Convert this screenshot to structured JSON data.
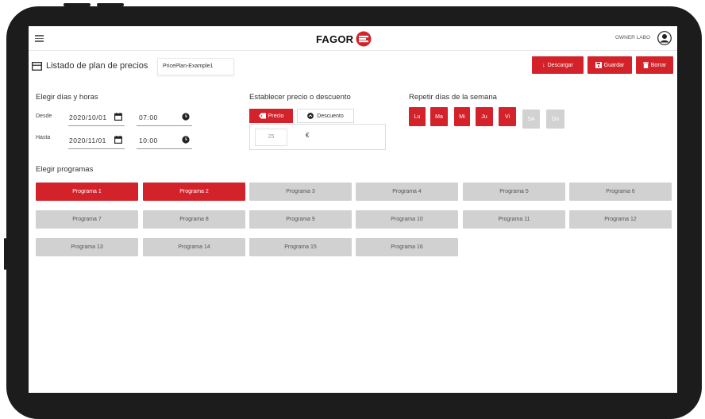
{
  "topbar": {
    "brand": "FAGOR",
    "owner": "OWNER LABO"
  },
  "header": {
    "title": "Listado de plan de precios",
    "plan_name": "PricePlan-Example1",
    "download_label": "Descargar",
    "save_label": "Guardar",
    "delete_label": "Borrar"
  },
  "schedule": {
    "title": "Elegir días y horas",
    "from_label": "Desde",
    "from_date": "2020/10/01",
    "from_time": "07:00",
    "to_label": "Hasta",
    "to_date": "2020/11/01",
    "to_time": "10:00"
  },
  "price": {
    "title": "Establecer precio o descuento",
    "price_label": "Precio",
    "discount_label": "Descuento",
    "value": "25",
    "currency": "€"
  },
  "days": {
    "title": "Repetir días de la semana",
    "items": [
      {
        "label": "Lu",
        "active": true
      },
      {
        "label": "Ma",
        "active": true
      },
      {
        "label": "Mi",
        "active": true
      },
      {
        "label": "Ju",
        "active": true
      },
      {
        "label": "Vi",
        "active": true
      },
      {
        "label": "SA",
        "active": false
      },
      {
        "label": "Do",
        "active": false
      }
    ]
  },
  "programs": {
    "title": "Elegir programas",
    "items": [
      {
        "label": "Programa 1",
        "active": true
      },
      {
        "label": "Programa 2",
        "active": true
      },
      {
        "label": "Programa 3",
        "active": false
      },
      {
        "label": "Programa 4",
        "active": false
      },
      {
        "label": "Programa 5",
        "active": false
      },
      {
        "label": "Programa 6",
        "active": false
      },
      {
        "label": "Programa 7",
        "active": false
      },
      {
        "label": "Programa 8",
        "active": false
      },
      {
        "label": "Programa 9",
        "active": false
      },
      {
        "label": "Programa 10",
        "active": false
      },
      {
        "label": "Programa 11",
        "active": false
      },
      {
        "label": "Programa 12",
        "active": false
      },
      {
        "label": "Programa 13",
        "active": false
      },
      {
        "label": "Programa 14",
        "active": false
      },
      {
        "label": "Programa 15",
        "active": false
      },
      {
        "label": "Programa 16",
        "active": false
      }
    ]
  },
  "colors": {
    "accent": "#d3222a",
    "inactive": "#d1d1d1"
  }
}
